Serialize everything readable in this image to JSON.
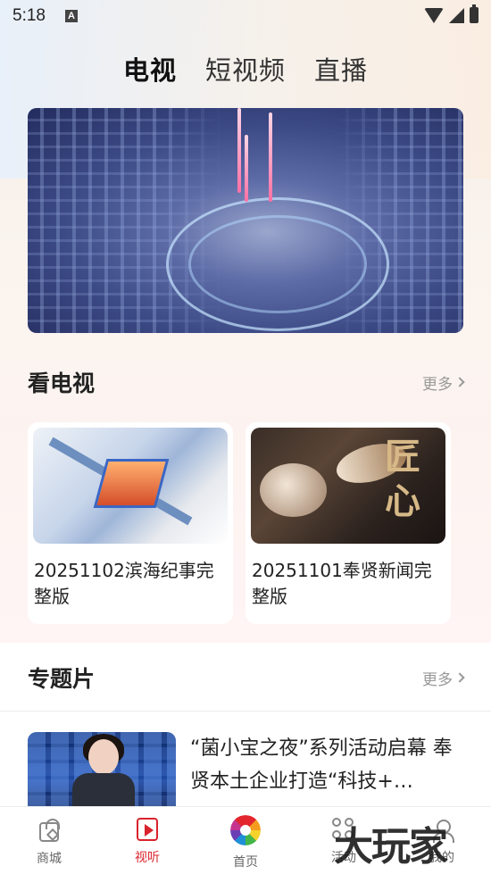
{
  "status_bar": {
    "time": "5:18",
    "notification_letter": "A"
  },
  "top_tabs": [
    {
      "label": "电视",
      "active": true
    },
    {
      "label": "短视频",
      "active": false
    },
    {
      "label": "直播",
      "active": false
    }
  ],
  "watch_tv": {
    "title": "看电视",
    "more_label": "更多",
    "items": [
      {
        "title": "20251102滨海纪事完整版"
      },
      {
        "title": "20251101奉贤新闻完整版",
        "thumb_seal": "匠心"
      }
    ]
  },
  "specials": {
    "title": "专题片",
    "more_label": "更多",
    "items": [
      {
        "title": "“菌小宝之夜”系列活动启幕 奉贤本土企业打造“科技+…"
      }
    ]
  },
  "bottom_nav": [
    {
      "label": "商城",
      "icon": "shopping-bag-icon",
      "active": false
    },
    {
      "label": "视听",
      "icon": "play-video-icon",
      "active": true
    },
    {
      "label": "首页",
      "icon": "home-logo-icon",
      "active": false
    },
    {
      "label": "活动",
      "icon": "activity-icon",
      "active": false
    },
    {
      "label": "我的",
      "icon": "profile-icon",
      "active": false
    }
  ],
  "watermark": "大玩家",
  "colors": {
    "accent": "#d9232d",
    "text": "#222222",
    "muted": "#999999"
  }
}
